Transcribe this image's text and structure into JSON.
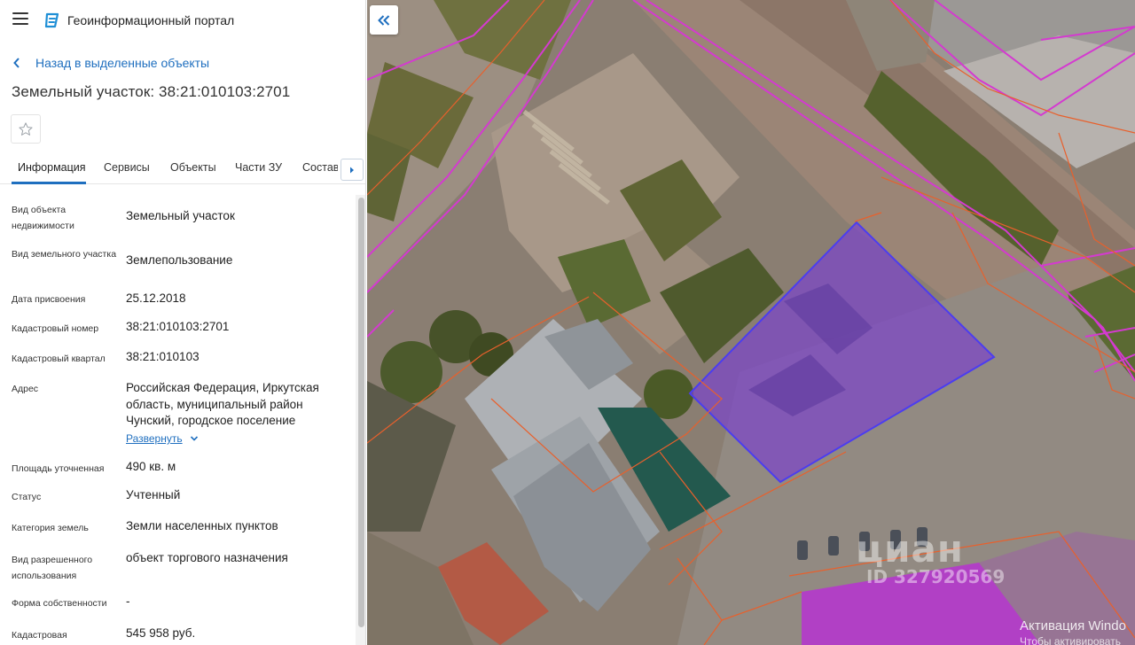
{
  "app": {
    "title": "Геоинформационный портал"
  },
  "nav": {
    "back_label": "Назад в выделенные объекты"
  },
  "object": {
    "title": "Земельный участок: 38:21:010103:2701"
  },
  "tabs": [
    {
      "label": "Информация",
      "active": true
    },
    {
      "label": "Сервисы"
    },
    {
      "label": "Объекты"
    },
    {
      "label": "Части ЗУ"
    },
    {
      "label": "Состав"
    }
  ],
  "info": {
    "rows": [
      {
        "label": "Вид объекта недвижимости",
        "value": "Земельный участок"
      },
      {
        "label": "Вид земельного участка",
        "value": "Землепользование"
      },
      {
        "label": "Дата присвоения",
        "value": "25.12.2018"
      },
      {
        "label": "Кадастровый номер",
        "value": "38:21:010103:2701"
      },
      {
        "label": "Кадастровый квартал",
        "value": "38:21:010103"
      },
      {
        "label": "Адрес",
        "value": "Российская Федерация, Иркутская область, муниципальный район Чунский, городское поселение"
      },
      {
        "label": "Площадь уточненная",
        "value": "490 кв. м"
      },
      {
        "label": "Статус",
        "value": "Учтенный"
      },
      {
        "label": "Категория земель",
        "value": "Земли населенных пунктов"
      },
      {
        "label": "Вид разрешенного использования",
        "value": "объект торгового назначения"
      },
      {
        "label": "Форма собственности",
        "value": "-"
      },
      {
        "label": "Кадастровая",
        "value": "545 958 руб."
      }
    ],
    "expand_label": "Развернуть"
  },
  "map": {
    "watermark_brand": "циан",
    "watermark_id": "ID 327920569",
    "os_notice_1": "Активация Windo",
    "os_notice_2": "Чтобы активировать"
  },
  "colors": {
    "accent": "#1f6fbf",
    "selected_parcel_fill": "#7b45c9",
    "selected_parcel_stroke": "#4b3df0",
    "boundary_magenta": "#d43ad0",
    "boundary_orange": "#e8602c",
    "magenta_parcel": "#c23ad0"
  }
}
